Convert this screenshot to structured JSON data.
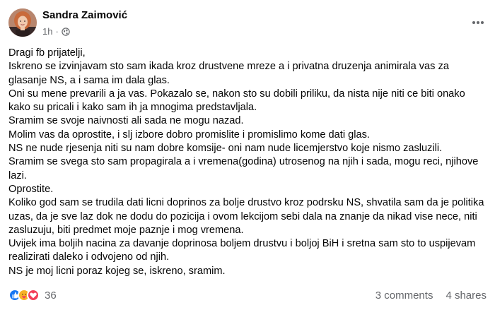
{
  "post": {
    "author": "Sandra Zaimović",
    "time": "1h",
    "separator": "·",
    "lines": [
      "Dragi fb prijatelji,",
      "Iskreno se izvinjavam sto sam ikada kroz drustvene mreze a i privatna druzenja animirala vas za glasanje NS, a i sama im dala glas.",
      "Oni su mene prevarili a ja vas. Pokazalo se, nakon sto su dobili priliku, da nista nije niti ce biti onako kako su pricali i kako sam ih ja mnogima predstavljala.",
      "Sramim se svoje naivnosti ali sada ne mogu nazad.",
      "Molim vas da oprostite, i slj izbore dobro promislite i promislimo kome dati glas.",
      "NS ne nude rjesenja niti su nam dobre komsije- oni nam nude licemjerstvo koje nismo zasluzili.",
      "Sramim se svega sto sam propagirala a i vremena(godina) utrosenog na njih i sada, mogu reci, njihove lazi.",
      "Oprostite.",
      "Koliko god sam se trudila dati licni doprinos za bolje drustvo kroz podrsku NS, shvatila sam da je politika uzas, da je sve laz dok ne dodu do pozicija i ovom lekcijom sebi dala na znanje da nikad vise nece, niti zasluzuju, biti predmet moje paznje i mog vremena.",
      "Uvijek ima boljih nacina za davanje doprinosa boljem drustvu i boljoj BiH i sretna sam sto to uspijevam realizirati daleko i odvojeno od njih.",
      "NS je moj licni poraz kojeg se, iskreno, sramim."
    ],
    "reaction_icons": [
      "like-icon",
      "care-icon",
      "love-icon"
    ],
    "reaction_count": "36",
    "comments": "3 comments",
    "shares": "4 shares"
  },
  "colors": {
    "like": "#1877f2",
    "love": "#f33e58",
    "care": "#f7b125",
    "muted": "#65676b"
  }
}
